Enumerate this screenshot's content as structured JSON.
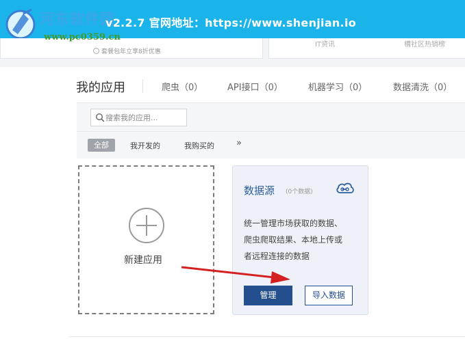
{
  "banner": {
    "text": "v2.2.7  官网地址：https://www.shenjian.io",
    "watermark_title": "河东软件园",
    "watermark_url": "www.pc0359.cn"
  },
  "top_cards": {
    "promo": "套餐包年立享8折优惠",
    "label_1": "IT资讯",
    "label_2": "槽社区热销榜"
  },
  "section": {
    "title": "我的应用",
    "tabs": [
      {
        "label": "爬虫（0）"
      },
      {
        "label": "API接口（0）"
      },
      {
        "label": "机器学习（0）"
      },
      {
        "label": "数据清洗（0）"
      }
    ]
  },
  "filter": {
    "search_placeholder": "搜索我的应用...",
    "all": "全部",
    "items": [
      {
        "label": "我开发的"
      },
      {
        "label": "我购买的"
      }
    ],
    "more": "»"
  },
  "new_app": {
    "label": "新建应用"
  },
  "data_source": {
    "title": "数据源",
    "count": "(0个数据)",
    "desc_lines": [
      "统一管理市场获取的数据、",
      "爬虫爬取结果、本地上传或",
      "者远程连接的数据"
    ],
    "manage_label": "管理",
    "import_label": "导入数据"
  },
  "colors": {
    "banner": "#1ab4ea",
    "accent": "#234f8f",
    "arrow": "#d42020"
  },
  "icons": [
    "logo-watermark-icon",
    "search-icon",
    "plus-icon",
    "link-icon",
    "arrow-annotation"
  ]
}
